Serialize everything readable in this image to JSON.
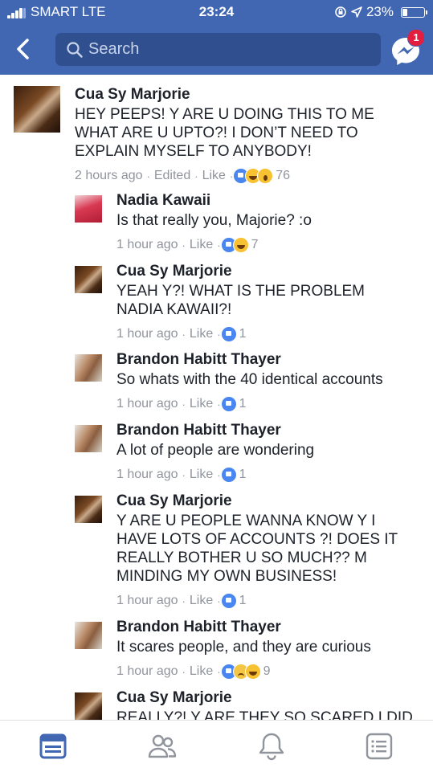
{
  "status_bar": {
    "carrier": "SMART  LTE",
    "time": "23:24",
    "battery": "23%",
    "battery_level": 0.23
  },
  "search": {
    "placeholder": "Search"
  },
  "messenger_badge": "1",
  "comments": [
    {
      "author": "Cua Sy Marjorie",
      "text": "HEY PEEPS! Y ARE U DOING THIS TO ME\nWHAT ARE U UPTO?! I DON’T NEED TO\nEXPLAIN MYSELF TO ANYBODY!",
      "time": "2 hours ago",
      "edited": "Edited",
      "like": "Like",
      "reactions": [
        "like",
        "haha",
        "wow"
      ],
      "count": "76"
    },
    {
      "author": "Nadia Kawaii",
      "text": "Is that really you, Majorie?  :o",
      "time": "1 hour ago",
      "like": "Like",
      "reactions": [
        "like",
        "haha"
      ],
      "count": "7"
    },
    {
      "author": "Cua Sy Marjorie",
      "text": "YEAH Y?! WHAT IS THE PROBLEM\nNADIA KAWAII?!",
      "time": "1 hour ago",
      "like": "Like",
      "reactions": [
        "like"
      ],
      "count": "1"
    },
    {
      "author": "Brandon Habitt Thayer",
      "text": "So whats with the 40 identical accounts",
      "time": "1 hour ago",
      "like": "Like",
      "reactions": [
        "like"
      ],
      "count": "1"
    },
    {
      "author": "Brandon Habitt Thayer",
      "text": "A lot of people are wondering",
      "time": "1 hour ago",
      "like": "Like",
      "reactions": [
        "like"
      ],
      "count": "1"
    },
    {
      "author": "Cua Sy Marjorie",
      "text": "Y ARE U PEOPLE WANNA KNOW Y I\nHAVE LOTS OF ACCOUNTS ?! DOES IT\nREALLY BOTHER U SO MUCH?? M\nMINDING MY OWN BUSINESS!",
      "time": "1 hour ago",
      "like": "Like",
      "reactions": [
        "like"
      ],
      "count": "1"
    },
    {
      "author": "Brandon Habitt Thayer",
      "text": "It scares people, and they are curious",
      "time": "1 hour ago",
      "like": "Like",
      "reactions": [
        "like",
        "sad",
        "haha"
      ],
      "count": "9"
    },
    {
      "author": "Cua Sy Marjorie",
      "text": "REALLY?! Y ARE THEY SO SCARED I DID",
      "time": "",
      "like": "",
      "reactions": [],
      "count": ""
    }
  ],
  "icons": {
    "back": "chevron-left-icon",
    "search": "search-icon",
    "messenger": "messenger-icon",
    "tabs": [
      "news-feed-icon",
      "friends-icon",
      "notifications-icon",
      "menu-icon"
    ]
  },
  "colors": {
    "brand": "#4267b2",
    "search_bg": "#2f4f8f",
    "badge": "#e41e3f",
    "meta": "#90949c",
    "active_tab": "#4267b2",
    "inactive_tab": "#90949c"
  }
}
